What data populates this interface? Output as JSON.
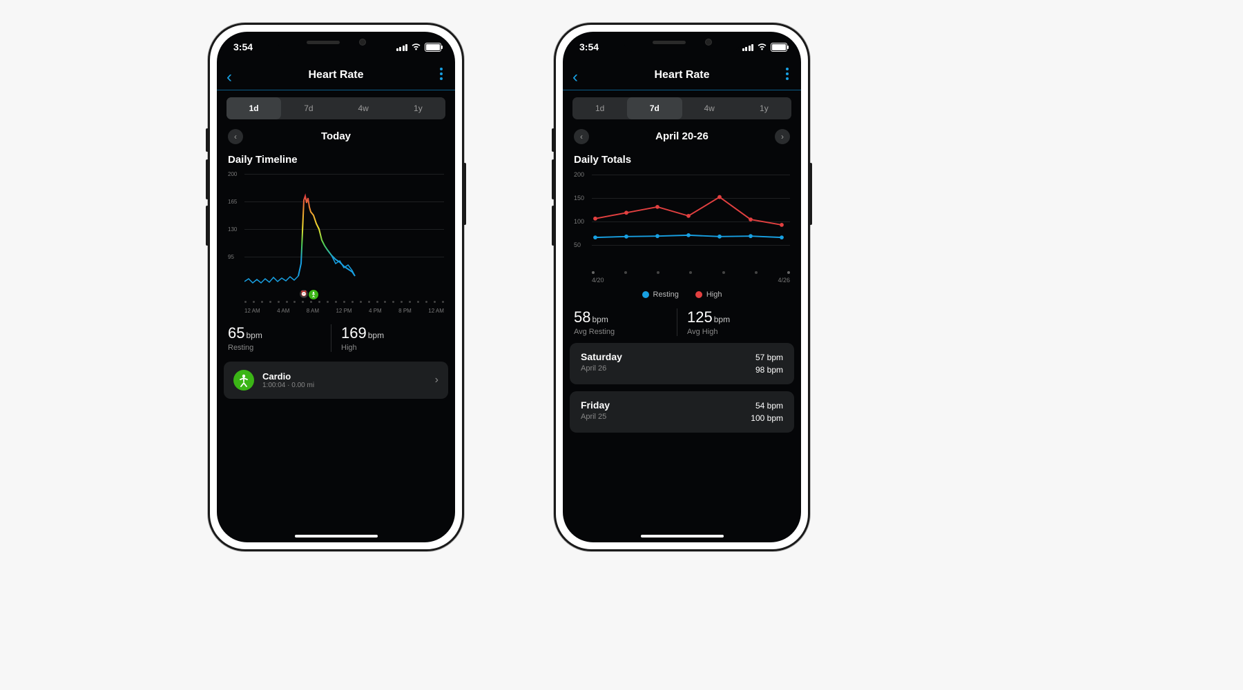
{
  "status": {
    "time": "3:54"
  },
  "nav": {
    "title": "Heart Rate"
  },
  "segments": [
    "1d",
    "7d",
    "4w",
    "1y"
  ],
  "phone1": {
    "active_seg": 0,
    "date_label": "Today",
    "section_title": "Daily Timeline",
    "y_ticks": [
      200,
      165,
      130,
      95
    ],
    "x_ticks": [
      "12 AM",
      "4 AM",
      "8 AM",
      "12 PM",
      "4 PM",
      "8 PM",
      "12 AM"
    ],
    "stat1": {
      "value": "65",
      "unit": "bpm",
      "caption": "Resting"
    },
    "stat2": {
      "value": "169",
      "unit": "bpm",
      "caption": "High"
    },
    "activity": {
      "title": "Cardio",
      "detail": "1:00:04 · 0.00 mi"
    }
  },
  "phone2": {
    "active_seg": 1,
    "date_label": "April 20-26",
    "section_title": "Daily Totals",
    "y_ticks": [
      200,
      150,
      100,
      50
    ],
    "x_first": "4/20",
    "x_last": "4/26",
    "legend": {
      "resting": "Resting",
      "high": "High"
    },
    "stat1": {
      "value": "58",
      "unit": "bpm",
      "caption": "Avg Resting"
    },
    "stat2": {
      "value": "125",
      "unit": "bpm",
      "caption": "Avg High"
    },
    "days": [
      {
        "name": "Saturday",
        "date": "April 26",
        "rest": "57 bpm",
        "high": "98 bpm"
      },
      {
        "name": "Friday",
        "date": "April 25",
        "rest": "54 bpm",
        "high": "100 bpm"
      }
    ]
  },
  "chart_data": [
    {
      "type": "line",
      "title": "Daily Timeline",
      "xlabel": "",
      "ylabel": "bpm",
      "ylim": [
        60,
        200
      ],
      "x_ticks": [
        "12 AM",
        "4 AM",
        "8 AM",
        "12 PM",
        "4 PM",
        "8 PM",
        "12 AM"
      ],
      "x": [
        0,
        1,
        2,
        3,
        4,
        5,
        5.5,
        6,
        6.3,
        6.6,
        7,
        7.3,
        7.6,
        8,
        8.5,
        9,
        9.5,
        10,
        10.5,
        11
      ],
      "values": [
        68,
        70,
        66,
        72,
        69,
        74,
        82,
        165,
        158,
        140,
        120,
        115,
        100,
        95,
        90,
        85,
        80,
        76,
        72,
        70
      ],
      "annotations": {
        "activity_marker_hour": 6.6
      }
    },
    {
      "type": "line",
      "title": "Daily Totals",
      "xlabel": "",
      "ylabel": "bpm",
      "ylim": [
        0,
        200
      ],
      "categories": [
        "4/20",
        "4/21",
        "4/22",
        "4/23",
        "4/24",
        "4/25",
        "4/26"
      ],
      "series": [
        {
          "name": "High",
          "color": "#e24040",
          "values": [
            102,
            115,
            128,
            108,
            150,
            100,
            88
          ]
        },
        {
          "name": "Resting",
          "color": "#18a0e2",
          "values": [
            60,
            62,
            63,
            65,
            62,
            63,
            60
          ]
        }
      ]
    }
  ],
  "colors": {
    "accent": "#18a0e2",
    "high": "#e24040",
    "activity": "#3bb516"
  }
}
